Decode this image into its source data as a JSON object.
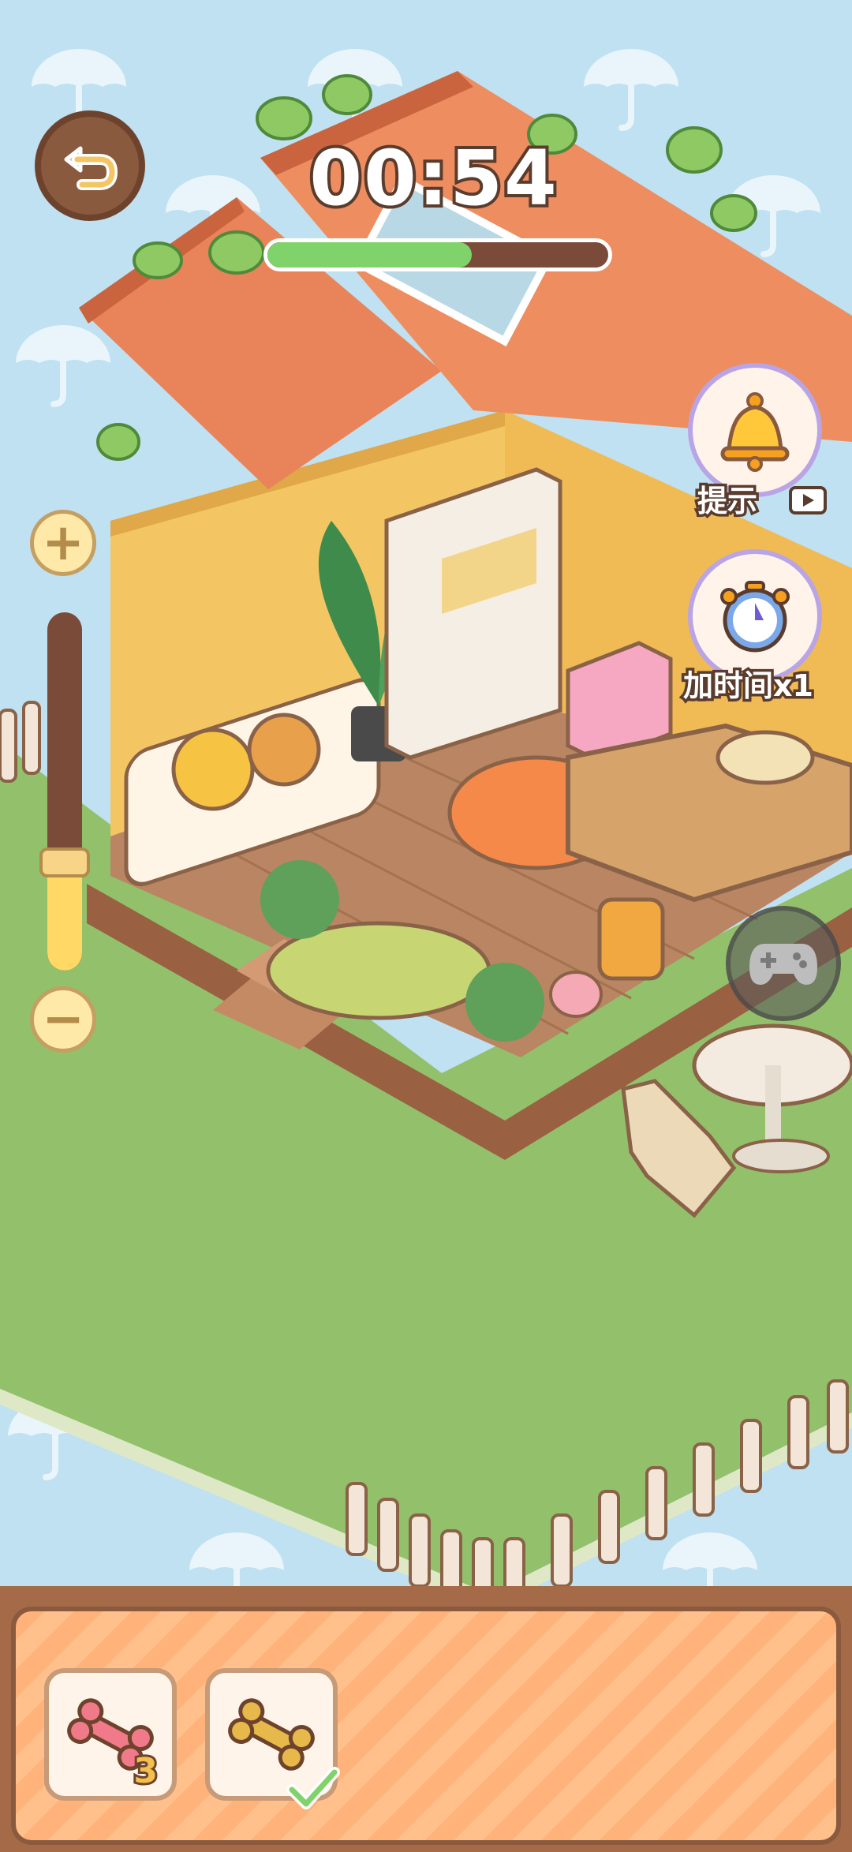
{
  "hud": {
    "timer": "00:54",
    "timer_progress": 0.6
  },
  "side_buttons": {
    "hint_label": "提示",
    "add_time_label": "加时间x1"
  },
  "zoom": {
    "plus": "+",
    "minus": "−",
    "level": 0.33
  },
  "items": [
    {
      "name": "pink bone",
      "count": "3",
      "color": "#f07a8a"
    },
    {
      "name": "golden bone",
      "color": "#e7b94a",
      "checked": true
    }
  ],
  "colors": {
    "sky": "#bfe1f1",
    "grass": "#93c06a",
    "roof": "#e9845a",
    "wall": "#f4c663",
    "floor": "#b98563",
    "tray_border": "#8a5a3e"
  }
}
